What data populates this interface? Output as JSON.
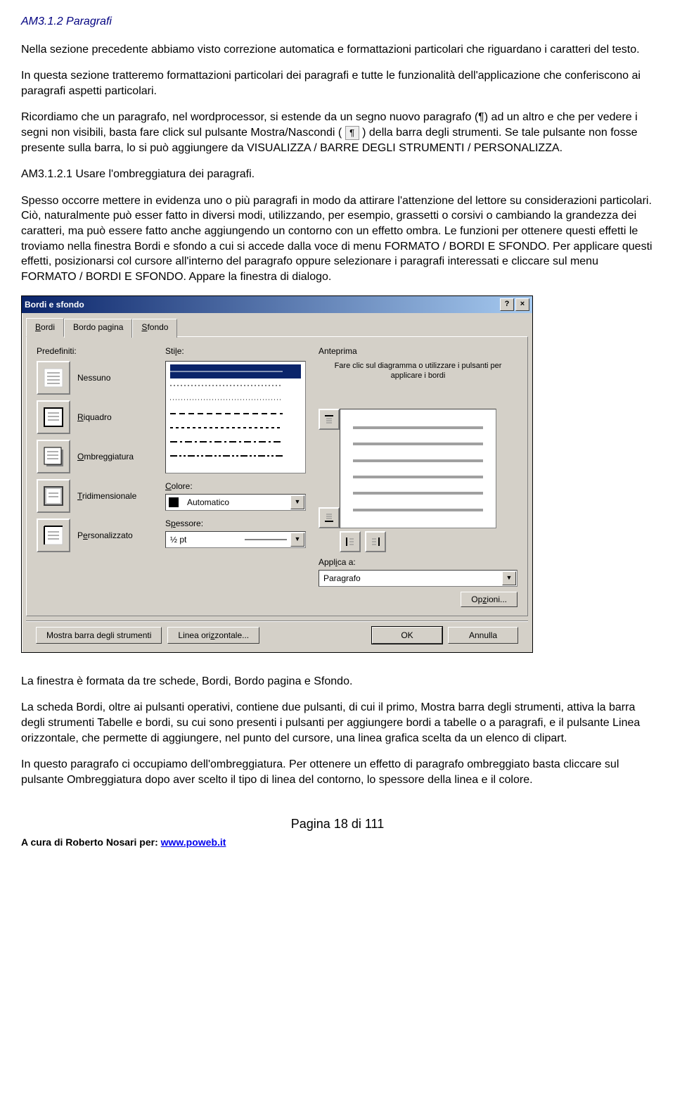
{
  "doc": {
    "heading": "AM3.1.2 Paragrafi",
    "p1": "Nella sezione precedente abbiamo visto correzione automatica e formattazioni particolari che riguardano i caratteri del testo.",
    "p2": "In questa sezione tratteremo formattazioni particolari dei paragrafi e tutte le funzionalità dell'applicazione che conferiscono ai paragrafi aspetti particolari.",
    "p3a": "Ricordiamo che un paragrafo, nel wordprocessor, si estende da un segno nuovo paragrafo (¶) ad un altro e che per vedere i segni non visibili, basta fare click sul pulsante Mostra/Nascondi (",
    "p3b": ") della barra degli strumenti. Se tale pulsante non fosse presente sulla barra, lo si può aggiungere da VISUALIZZA / BARRE DEGLI STRUMENTI / PERSONALIZZA.",
    "subheading": "AM3.1.2.1 Usare l'ombreggiatura dei paragrafi.",
    "p4": "Spesso occorre mettere in evidenza uno o più paragrafi in modo da attirare l'attenzione del lettore su considerazioni particolari. Ciò, naturalmente può esser fatto in diversi modi, utilizzando, per esempio, grassetti o corsivi o cambiando la grandezza dei caratteri, ma può essere fatto anche aggiungendo un contorno con un effetto ombra. Le funzioni per ottenere questi effetti le troviamo nella finestra Bordi e sfondo a cui si accede dalla voce di menu FORMATO / BORDI E SFONDO. Per applicare questi effetti, posizionarsi col cursore all'interno del paragrafo oppure selezionare i paragrafi interessati e cliccare sul menu FORMATO / BORDI E SFONDO. Appare la finestra di dialogo.",
    "p5": "La finestra è formata da tre schede, Bordi, Bordo pagina e Sfondo.",
    "p6": "La scheda Bordi, oltre ai pulsanti operativi, contiene due pulsanti, di cui il primo, Mostra barra degli strumenti, attiva la barra degli strumenti Tabelle e bordi, su cui sono presenti i pulsanti per aggiungere bordi a tabelle o a paragrafi, e il pulsante Linea orizzontale, che permette di aggiungere, nel punto del cursore, una linea grafica scelta da un elenco di clipart.",
    "p7": "In questo paragrafo ci occupiamo dell'ombreggiatura. Per ottenere un effetto di paragrafo ombreggiato basta cliccare sul pulsante Ombreggiatura dopo aver scelto il tipo di linea del contorno, lo spessore della linea e il colore."
  },
  "dialog": {
    "title": "Bordi e sfondo",
    "help_btn": "?",
    "close_btn": "×",
    "tabs": {
      "t1": "Bordi",
      "t2": "Bordo pagina",
      "t3": "Sfondo"
    },
    "sections": {
      "predef": "Predefiniti:",
      "style": "Stile:",
      "color": "Colore:",
      "weight": "Spessore:",
      "preview": "Anteprima",
      "apply": "Applica a:"
    },
    "presets": {
      "none": "Nessuno",
      "box": "Riquadro",
      "shadow": "Ombreggiatura",
      "threeD": "Tridimensionale",
      "custom": "Personalizzato"
    },
    "color_value": "Automatico",
    "weight_value": "½ pt",
    "apply_value": "Paragrafo",
    "preview_hint": "Fare clic sul diagramma o utilizzare i pulsanti per applicare i bordi",
    "buttons": {
      "options": "Opzioni...",
      "toolbar": "Mostra barra degli strumenti",
      "hline": "Linea orizzontale...",
      "ok": "OK",
      "cancel": "Annulla"
    }
  },
  "footer": {
    "page": "Pagina 18 di 111",
    "credit_pre": "A cura di Roberto Nosari per: ",
    "link": "www.poweb.it"
  }
}
